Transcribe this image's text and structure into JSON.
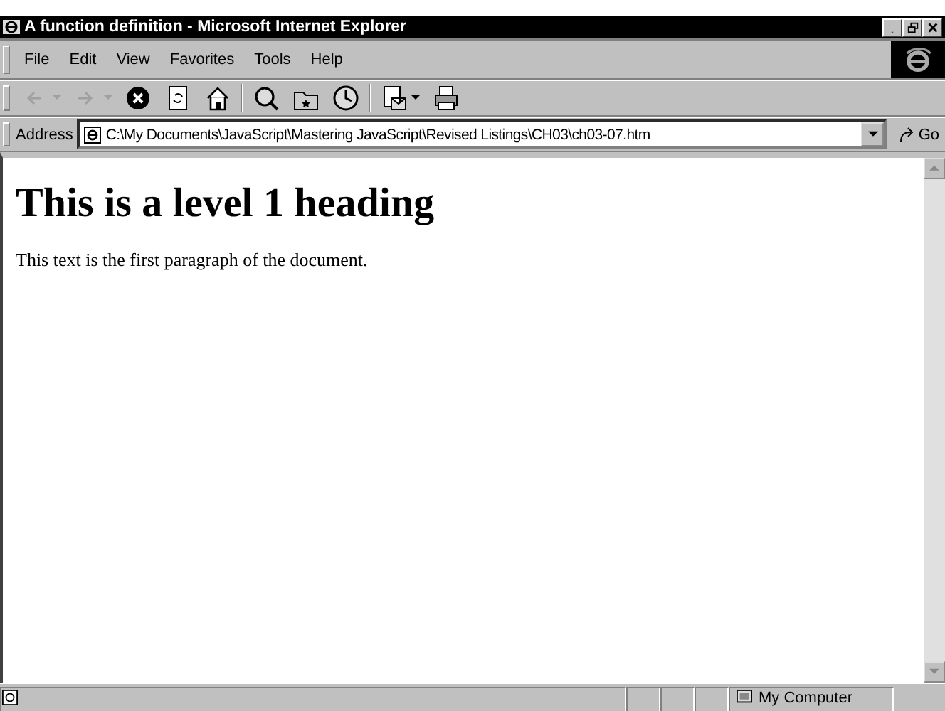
{
  "window": {
    "title": "A function definition - Microsoft Internet Explorer"
  },
  "menu": [
    {
      "label": "File"
    },
    {
      "label": "Edit"
    },
    {
      "label": "View"
    },
    {
      "label": "Favorites"
    },
    {
      "label": "Tools"
    },
    {
      "label": "Help"
    }
  ],
  "toolbar": [
    {
      "kind": "back",
      "disabled": true
    },
    {
      "kind": "forward",
      "disabled": true
    },
    {
      "kind": "stop",
      "disabled": false
    },
    {
      "kind": "refresh",
      "disabled": false
    },
    {
      "kind": "home",
      "disabled": false
    },
    {
      "kind": "search",
      "disabled": false
    },
    {
      "kind": "favorites",
      "disabled": false
    },
    {
      "kind": "history",
      "disabled": false
    },
    {
      "kind": "mail",
      "disabled": false
    },
    {
      "kind": "print",
      "disabled": false
    }
  ],
  "address": {
    "label": "Address",
    "value": "C:\\My Documents\\JavaScript\\Mastering JavaScript\\Revised Listings\\CH03\\ch03-07.htm",
    "go": "Go"
  },
  "document": {
    "heading": "This is a level 1 heading",
    "paragraph": "This text is the first paragraph of the document."
  },
  "status_bar": {
    "zone": "My Computer"
  }
}
